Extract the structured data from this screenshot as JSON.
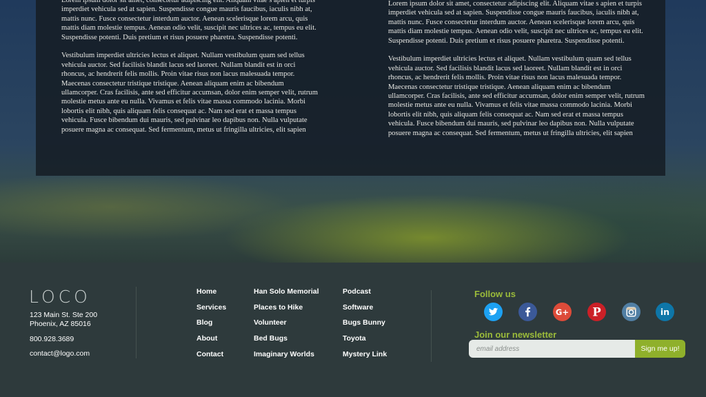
{
  "content": {
    "left": {
      "p1": "Lorem ipsum dolor sit amet, consectetur adipiscing elit. Aliquam vitae s apien et turpis imperdiet vehicula sed at sapien. Suspendisse congue mauris faucibus, iaculis nibh at, mattis nunc. Fusce consectetur interdum auctor. Aenean scelerisque lorem arcu, quis mattis diam molestie tempus. Aenean odio velit, suscipit nec ultrices ac, tempus eu elit. Suspendisse potenti. Duis pretium et risus posuere pharetra. Suspendisse potenti.",
      "p2": "Vestibulum imperdiet ultricies lectus et aliquet. Nullam vestibulum quam sed tellus vehicula auctor. Sed facilisis blandit lacus sed laoreet. Nullam blandit est in orci rhoncus, ac hendrerit felis mollis. Proin vitae risus non lacus malesuada tempor. Maecenas consectetur tristique tristique. Aenean aliquam enim ac bibendum ullamcorper. Cras facilisis, ante sed efficitur accumsan, dolor enim semper velit, rutrum molestie metus ante eu nulla. Vivamus et felis vitae massa commodo lacinia. Morbi lobortis elit nibh, quis aliquam felis consequat ac. Nam sed erat et massa tempus vehicula. Fusce bibendum dui mauris, sed pulvinar leo dapibus non. Nulla vulputate posuere magna ac consequat. Sed fermentum, metus ut fringilla ultricies, elit sapien"
    },
    "right": {
      "p1": "Lorem ipsum dolor sit amet, consectetur adipiscing elit. Aliquam vitae s apien et turpis imperdiet vehicula sed at sapien. Suspendisse congue mauris faucibus, iaculis nibh at, mattis nunc. Fusce consectetur interdum auctor. Aenean scelerisque lorem arcu, quis mattis diam molestie tempus. Aenean odio velit, suscipit nec ultrices ac, tempus eu elit. Suspendisse potenti. Duis pretium et risus posuere pharetra. Suspendisse potenti.",
      "p2": "Vestibulum imperdiet ultricies lectus et aliquet. Nullam vestibulum quam sed tellus vehicula auctor. Sed facilisis blandit lacus sed laoreet. Nullam blandit est in orci rhoncus, ac hendrerit felis mollis. Proin vitae risus non lacus malesuada tempor. Maecenas consectetur tristique tristique. Aenean aliquam enim ac bibendum ullamcorper. Cras facilisis, ante sed efficitur accumsan, dolor enim semper velit, rutrum molestie metus ante eu nulla. Vivamus et felis vitae massa commodo lacinia. Morbi lobortis elit nibh, quis aliquam felis consequat ac. Nam sed erat et massa tempus vehicula. Fusce bibendum dui mauris, sed pulvinar leo dapibus non. Nulla vulputate posuere magna ac consequat. Sed fermentum, metus ut fringilla ultricies, elit sapien"
    }
  },
  "footer": {
    "logo": "LOCO",
    "address_line1": "123 Main St. Ste 200",
    "address_line2": "Phoenix, AZ 85016",
    "phone": "800.928.3689",
    "email": "contact@logo.com",
    "nav_col1": [
      "Home",
      "Services",
      "Blog",
      "About",
      "Contact"
    ],
    "nav_col2": [
      "Han Solo Memorial",
      "Places to Hike",
      "Volunteer",
      "Bed Bugs",
      "Imaginary Worlds"
    ],
    "nav_col3": [
      "Podcast",
      "Software",
      "Bugs Bunny",
      "Toyota",
      "Mystery Link"
    ],
    "follow_title": "Follow us",
    "social": [
      "twitter-icon",
      "facebook-icon",
      "google-plus-icon",
      "pinterest-icon",
      "instagram-icon",
      "linkedin-icon"
    ],
    "newsletter_title": "Join our newsletter",
    "newsletter_placeholder": "email address",
    "newsletter_button": "Sign me up!"
  },
  "colors": {
    "accent_green": "#9bbb3a",
    "button_green": "#8fb02b",
    "footer_bg": "#2e3a3c",
    "twitter": "#1da1f2",
    "facebook": "#3b5998",
    "google_plus": "#dd4b39",
    "pinterest": "#cb2027",
    "instagram": "#517fa4",
    "linkedin": "#0e76a8"
  }
}
